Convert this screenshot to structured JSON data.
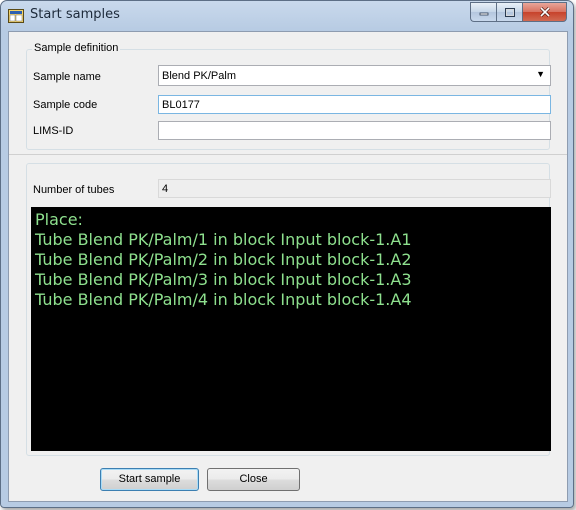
{
  "window": {
    "title": "Start samples"
  },
  "sample_definition": {
    "legend": "Sample definition",
    "name_label": "Sample name",
    "name_value": "Blend PK/Palm",
    "code_label": "Sample code",
    "code_value": "BL0177",
    "lims_label": "LIMS-ID",
    "lims_value": ""
  },
  "tubes": {
    "label": "Number of tubes",
    "value": "4"
  },
  "console": {
    "lines": [
      "Place:",
      "Tube Blend PK/Palm/1 in block Input block-1.A1",
      "Tube Blend PK/Palm/2 in block Input block-1.A2",
      "Tube Blend PK/Palm/3 in block Input block-1.A3",
      "Tube Blend PK/Palm/4 in block Input block-1.A4"
    ],
    "text_color": "#8ee08e",
    "background": "#000000"
  },
  "buttons": {
    "start": "Start sample",
    "close": "Close"
  },
  "icons": [
    "app-window-icon",
    "minimize-icon",
    "maximize-icon",
    "close-icon",
    "chevron-down-icon"
  ]
}
